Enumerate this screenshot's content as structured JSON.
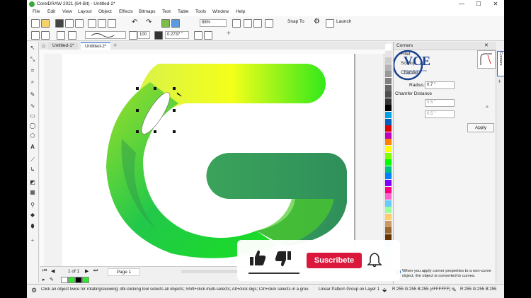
{
  "window": {
    "title": "CorelDRAW 2021 (64-Bit) - Untitled-2*",
    "minimize": "—",
    "maximize": "☐",
    "close": "✕"
  },
  "menu": [
    "File",
    "Edit",
    "View",
    "Layout",
    "Object",
    "Effects",
    "Bitmaps",
    "Text",
    "Table",
    "Tools",
    "Window",
    "Help"
  ],
  "toolbar": {
    "zoom": "88%",
    "snap_to": "Snap To",
    "launch": "Launch"
  },
  "property_bar": {
    "outline_width": "100",
    "outline_size": "0.2737 \""
  },
  "tabs": [
    "Untitled-1*",
    "Untitled-2*"
  ],
  "page_nav": {
    "counter": "1 of 1",
    "page_label": "Page 1"
  },
  "docker": {
    "title": "Corners",
    "options": [
      "Fillet",
      "Scallop",
      "Chamfer"
    ],
    "radius_label": "Radius:",
    "radius_value": "0.7 \"",
    "chamfer_label": "Chamfer Distance",
    "chamfer_1": "0.5 \"",
    "chamfer_2": "0.5 \"",
    "apply": "Apply",
    "info": "When you apply corner properties to a non-curve object, the object is converted to curves.",
    "side_tab": "Corners"
  },
  "watermark": {
    "logo": "VCE",
    "sub": "VIRTUAL CLASSROOM EXPERIENCE"
  },
  "overlay": {
    "subscribe": "Suscribete"
  },
  "status": {
    "hint": "Click an object twice for rotating/skewing; dbl-clicking tool selects all objects; Shift+click multi-selects; Alt+click digs; Ctrl+click selects in a group",
    "selection": "Linear Pattern Group on Layer 1",
    "fill": "R:255 G:255 B:255 (#FFFFFF)",
    "outline": "R:255 G:255 B:255"
  },
  "palette_colors": [
    "#ffffff",
    "#e6e6e6",
    "#cccccc",
    "#b3b3b3",
    "#999999",
    "#808080",
    "#666666",
    "#4d4d4d",
    "#333333",
    "#000000",
    "#00a0e0",
    "#0060c0",
    "#e00000",
    "#c000c0",
    "#ff8000",
    "#ffff00",
    "#80ff00",
    "#00ff00",
    "#00c080",
    "#0080ff",
    "#8000ff",
    "#ff0080",
    "#ff66cc",
    "#66ccff",
    "#99ff99",
    "#ffcc66",
    "#cc9966",
    "#996633",
    "#663300",
    "#00ffff",
    "#80ffff",
    "#b0e0e0",
    "#c0f0d0",
    "#d0f0f0"
  ],
  "accent": "#d9183b"
}
